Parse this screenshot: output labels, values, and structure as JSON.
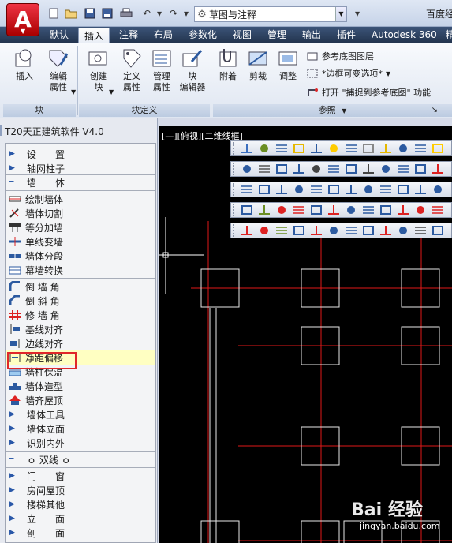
{
  "titlebar": {
    "workspace": "草图与注释",
    "window_title": "百度经"
  },
  "tabs": [
    "默认",
    "插入",
    "注释",
    "布局",
    "参数化",
    "视图",
    "管理",
    "输出",
    "插件",
    "Autodesk 360",
    "精"
  ],
  "ribbon": {
    "panels": {
      "block": {
        "footer": "块",
        "buttons": [
          "插入",
          "编辑\n属性"
        ]
      },
      "block_def": {
        "footer": "块定义",
        "buttons": [
          "创建\n块",
          "定义\n属性",
          "管理\n属性",
          "块\n编辑器"
        ]
      },
      "reference": {
        "footer": "参照",
        "buttons": [
          "附着",
          "剪裁",
          "调整"
        ],
        "small": [
          "参考底图图层",
          "*边框可变选项*",
          "打开 \"捕捉到参考底图\" 功能"
        ]
      }
    }
  },
  "palette": {
    "title": "T20天正建筑软件 V4.0",
    "items": [
      {
        "label": "设　　置",
        "type": "menu"
      },
      {
        "label": "轴网柱子",
        "type": "menu"
      },
      {
        "label": "墙　　体",
        "type": "open"
      },
      {
        "label": "绘制墙体",
        "type": "tool"
      },
      {
        "label": "墙体切割",
        "type": "tool"
      },
      {
        "label": "等分加墙",
        "type": "tool"
      },
      {
        "label": "单线变墙",
        "type": "tool"
      },
      {
        "label": "墙体分段",
        "type": "tool"
      },
      {
        "label": "幕墙转换",
        "type": "tool"
      },
      {
        "label": "倒 墙 角",
        "type": "tool"
      },
      {
        "label": "倒 斜 角",
        "type": "tool"
      },
      {
        "label": "修 墙 角",
        "type": "tool"
      },
      {
        "label": "基线对齐",
        "type": "tool"
      },
      {
        "label": "边线对齐",
        "type": "tool"
      },
      {
        "label": "净距偏移",
        "type": "tool"
      },
      {
        "label": "墙柱保温",
        "type": "tool"
      },
      {
        "label": "墙体造型",
        "type": "tool"
      },
      {
        "label": "墙齐屋顶",
        "type": "tool"
      },
      {
        "label": "墙体工具",
        "type": "menu"
      },
      {
        "label": "墙体立面",
        "type": "menu"
      },
      {
        "label": "识别内外",
        "type": "menu"
      },
      {
        "label": "ｏ 双线 ｏ",
        "type": "open"
      },
      {
        "label": "门　　窗",
        "type": "menu"
      },
      {
        "label": "房间屋顶",
        "type": "menu"
      },
      {
        "label": "楼梯其他",
        "type": "menu"
      },
      {
        "label": "立　　面",
        "type": "menu"
      },
      {
        "label": "剖　　面",
        "type": "menu"
      }
    ],
    "selected_label": "净距偏移"
  },
  "viewport": {
    "label": "[—][俯视][二维线框]"
  },
  "watermark": {
    "brand": "Bai 经验",
    "url": "jingyan.baidu.com"
  },
  "colors": {
    "accent_red": "#e0282a",
    "grid_red": "#e01818",
    "selected_bg": "#ffffc2"
  }
}
